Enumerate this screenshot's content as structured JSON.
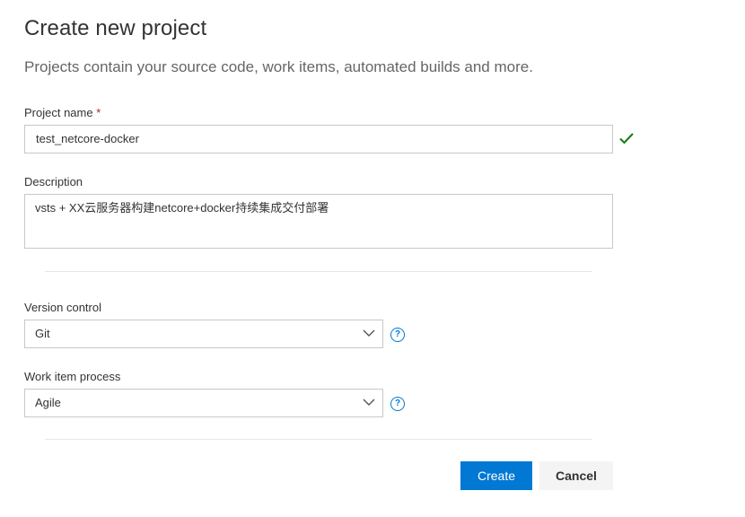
{
  "header": {
    "title": "Create new project",
    "subtitle": "Projects contain your source code, work items, automated builds and more."
  },
  "form": {
    "project_name": {
      "label": "Project name",
      "required_marker": "*",
      "value": "test_netcore-docker",
      "valid_icon": "checkmark-icon",
      "valid_color": "#107c10"
    },
    "description": {
      "label": "Description",
      "value": "vsts + XX云服务器构建netcore+docker持续集成交付部署"
    },
    "version_control": {
      "label": "Version control",
      "selected": "Git",
      "help_icon": "?"
    },
    "work_item_process": {
      "label": "Work item process",
      "selected": "Agile",
      "help_icon": "?"
    }
  },
  "actions": {
    "create_label": "Create",
    "cancel_label": "Cancel"
  },
  "colors": {
    "accent": "#0078d4",
    "required": "#a4262c"
  }
}
